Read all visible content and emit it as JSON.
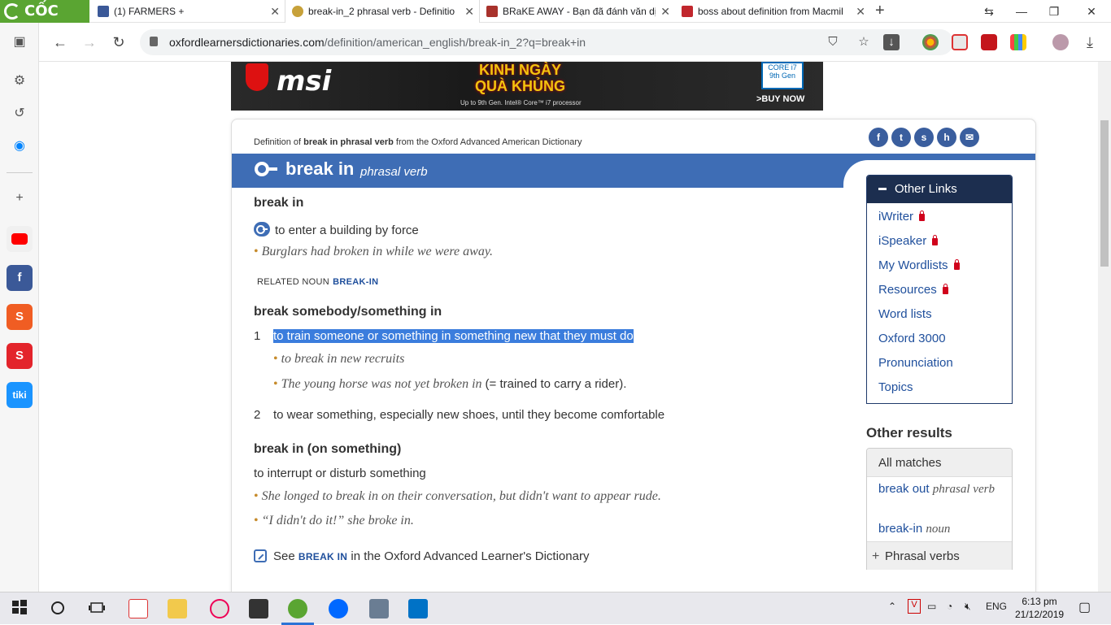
{
  "browser": {
    "brand": "CỐC CỐC",
    "tabs": [
      {
        "title": "(1) FARMERS +"
      },
      {
        "title": "break-in_2 phrasal verb - Definitio"
      },
      {
        "title": "BRaKE AWAY - Bạn đã đánh văn dị"
      },
      {
        "title": "boss about definition from Macmil"
      }
    ],
    "url_host": "oxfordlearnersdictionaries.com",
    "url_path": "/definition/american_english/break-in_2?q=break+in"
  },
  "ad": {
    "brand": "msi",
    "promo_line1": "KINH NGÀY",
    "promo_line2": "QUÀ KHỦNG",
    "fine_print": "Up to 9th Gen. Intel® Core™ i7 processor",
    "cpu_badge": "CORE i7",
    "cpu_gen": "9th Gen",
    "cta": ">BUY NOW"
  },
  "entry": {
    "definition_of_prefix": "Definition of ",
    "definition_of_word": "break in phrasal verb",
    "definition_of_suffix": " from the Oxford Advanced American Dictionary",
    "headword": "break in",
    "pos": "phrasal verb",
    "senses": {
      "s1_phrase": "break in",
      "s1_def": "to enter a building by force",
      "s1_example": "Burglars had broken in while we were away.",
      "s1_related_label": "RELATED NOUN",
      "s1_related_link": "BREAK-IN",
      "s2_phrase": "break somebody/something in",
      "s2_1_num": "1",
      "s2_1_def": "to train someone or something in something new that they must do",
      "s2_1_ex1": "to break in new recruits",
      "s2_1_ex2": "The young horse was not yet broken in",
      "s2_1_ex2_gloss": "(= trained to carry a rider).",
      "s2_2_num": "2",
      "s2_2_def": "to wear something, especially new shoes, until they become comfortable",
      "s3_phrase": "break in (on something)",
      "s3_def": "to interrupt or disturb something",
      "s3_ex1": "She longed to break in on their conversation, but didn't want to appear rude.",
      "s3_ex2": "“I didn't do it!” she broke in."
    },
    "see_prefix": "See ",
    "see_link": "BREAK IN",
    "see_suffix": " in the Oxford Advanced Learner's Dictionary"
  },
  "share_icons": [
    "facebook-icon",
    "twitter-icon",
    "stumbleupon-icon",
    "hi5-icon",
    "email-icon"
  ],
  "other_links": {
    "title": "Other Links",
    "items": [
      "iWriter",
      "iSpeaker",
      "My Wordlists",
      "Resources",
      "Word lists",
      "Oxford 3000",
      "Pronunciation",
      "Topics"
    ]
  },
  "other_results": {
    "title": "Other results",
    "tab": "All matches",
    "r1_word": "break out",
    "r1_pos": "phrasal verb",
    "r2_word": "break-in",
    "r2_pos": "noun",
    "phrasal_label": "Phrasal verbs"
  },
  "taskbar": {
    "lang": "ENG",
    "time": "6:13 pm",
    "date": "21/12/2019"
  },
  "colors": {
    "oxford_blue": "#3e6db5",
    "links_header": "#1c2e4f",
    "selection": "#3b7ddd",
    "browser_green": "#5aa532"
  }
}
